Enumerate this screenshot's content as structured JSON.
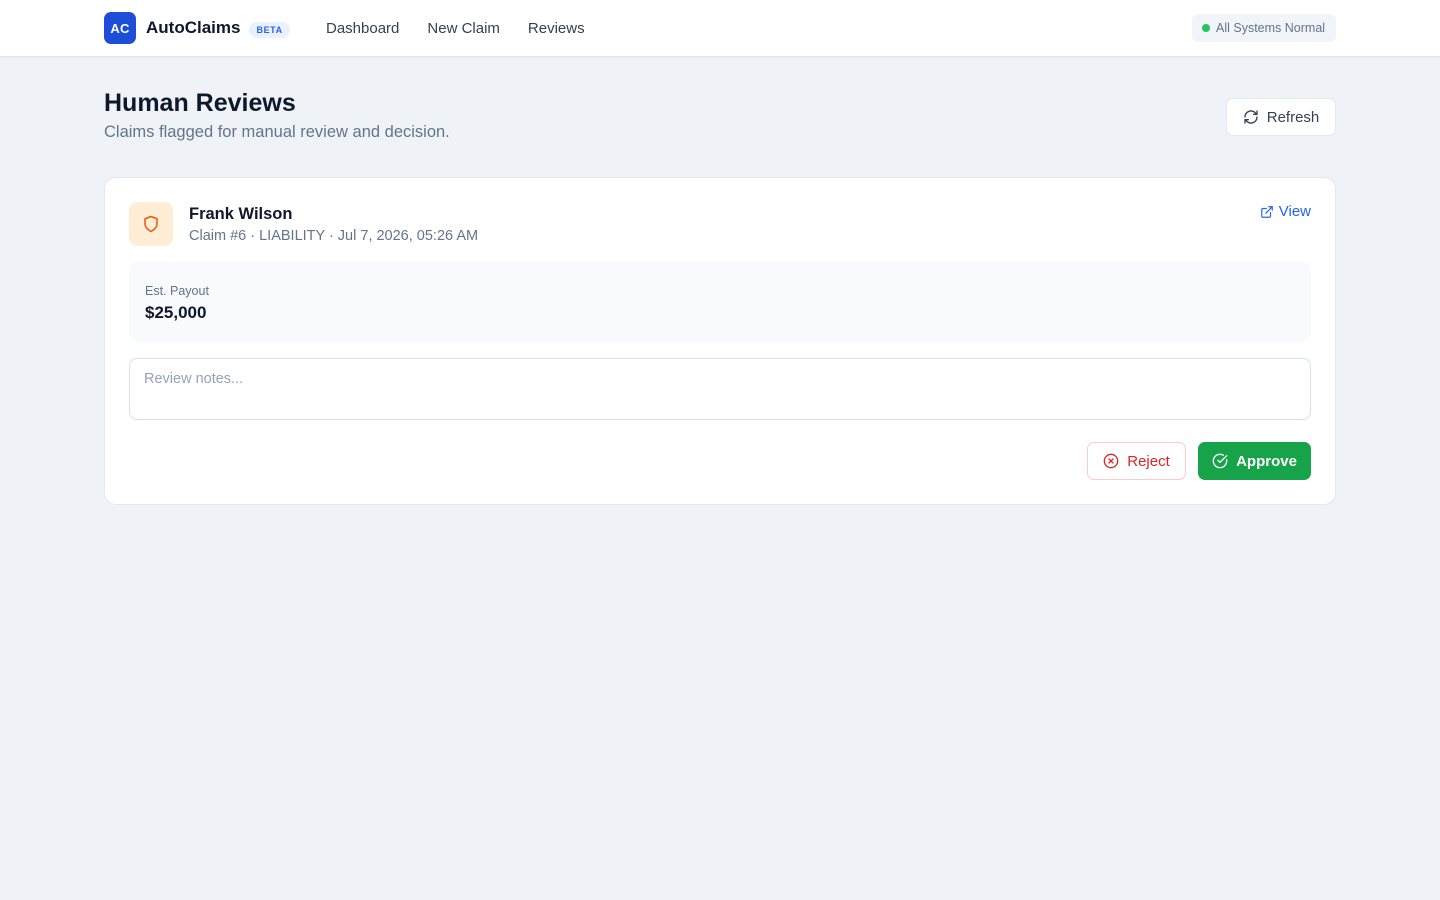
{
  "header": {
    "logo_text": "AC",
    "app_name": "AutoClaims",
    "badge": "BETA",
    "nav": [
      {
        "label": "Dashboard"
      },
      {
        "label": "New Claim"
      },
      {
        "label": "Reviews"
      }
    ],
    "status": "All Systems Normal",
    "status_color": "#22c55e"
  },
  "page": {
    "title": "Human Reviews",
    "subtitle": "Claims flagged for manual review and decision.",
    "refresh_label": "Refresh"
  },
  "claims": [
    {
      "icon": "shield-icon",
      "claimant": "Frank Wilson",
      "meta": "Claim #6 · LIABILITY · Jul 7, 2026, 05:26 AM",
      "view_label": "View",
      "payout_label": "Est. Payout",
      "payout_value": "$25,000",
      "notes_placeholder": "Review notes...",
      "notes_value": "",
      "reject_label": "Reject",
      "approve_label": "Approve"
    }
  ],
  "colors": {
    "brand": "#1d4ed8",
    "approve": "#16a34a",
    "reject": "#dc2626",
    "link": "#2563eb",
    "shield": "#ea580c"
  }
}
